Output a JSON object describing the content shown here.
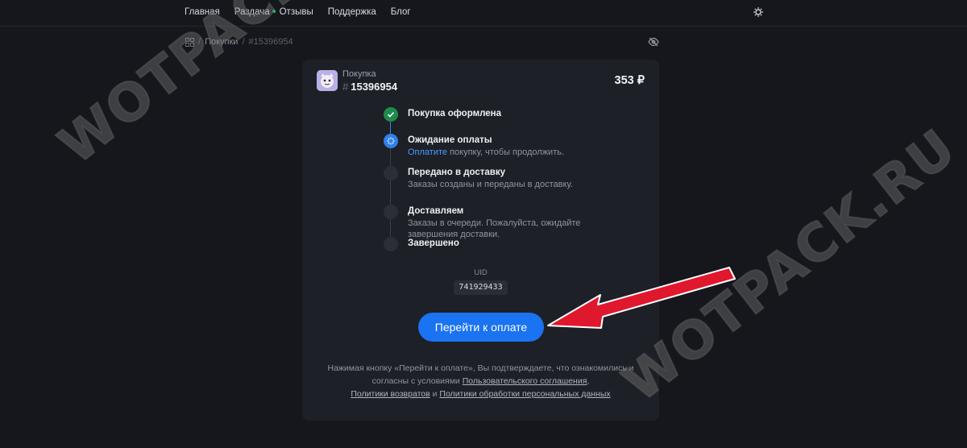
{
  "nav": {
    "items": [
      "Главная",
      "Раздача",
      "Отзывы",
      "Поддержка",
      "Блог"
    ]
  },
  "breadcrumb": {
    "sep": "/",
    "section": "Покупки",
    "current": "#15396954"
  },
  "purchase": {
    "label": "Покупка",
    "hash": "#",
    "id": "15396954",
    "price": "353 ₽"
  },
  "steps": [
    {
      "title": "Покупка оформлена",
      "status": "done"
    },
    {
      "title": "Ожидание оплаты",
      "status": "active",
      "desc_link": "Оплатите",
      "desc_rest": " покупку, чтобы продолжить."
    },
    {
      "title": "Передано в доставку",
      "status": "pending",
      "desc": "Заказы созданы и переданы в доставку."
    },
    {
      "title": "Доставляем",
      "status": "pending",
      "desc": "Заказы в очереди. Пожалуйста, ожидайте завершения доставки."
    },
    {
      "title": "Завершено",
      "status": "pending"
    }
  ],
  "uid": {
    "label": "UID",
    "value": "741929433"
  },
  "pay_button": "Перейти к оплате",
  "legal": {
    "text1": "Нажимая кнопку «Перейти к оплате», Вы подтверждаете, что ознакомились и согласны с условиями ",
    "link1": "Пользовательского соглашения",
    "text2": ",",
    "link2": "Политики возвратов",
    "text3": " и ",
    "link3": "Политики обработки персональных данных"
  },
  "watermark": "WOTPACK.RU",
  "colors": {
    "accent": "#1a73f0",
    "done": "#1f8a4c",
    "arrow": "#e0182d"
  }
}
